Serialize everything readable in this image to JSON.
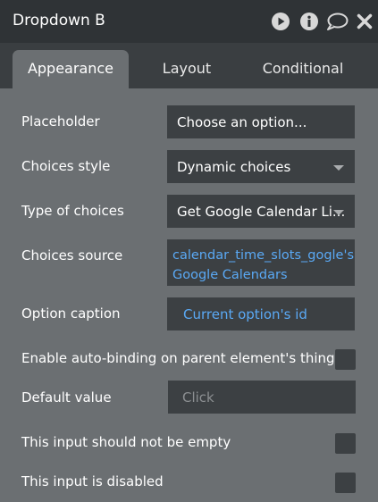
{
  "header": {
    "title": "Dropdown B",
    "icons": [
      "play-icon",
      "info-icon",
      "comment-icon",
      "close-icon"
    ]
  },
  "tabs": [
    {
      "label": "Appearance",
      "active": true
    },
    {
      "label": "Layout",
      "active": false
    },
    {
      "label": "Conditional",
      "active": false
    }
  ],
  "fields": {
    "placeholder": {
      "label": "Placeholder",
      "value": "Choose an option..."
    },
    "choices_style": {
      "label": "Choices style",
      "value": "Dynamic choices"
    },
    "type_of_choices": {
      "label": "Type of choices",
      "value": "Get Google Calendar Li..."
    },
    "choices_source": {
      "label": "Choices source",
      "line1": "calendar_time_slots_gogle's",
      "line2": "Google Calendars"
    },
    "option_caption": {
      "label": "Option caption",
      "value": "Current option's id"
    },
    "auto_binding": {
      "label": "Enable auto-binding on parent element's thing"
    },
    "default_value": {
      "label": "Default value",
      "placeholder": "Click"
    },
    "not_empty": {
      "label": "This input should not be empty"
    },
    "disabled": {
      "label": "This input is disabled"
    }
  },
  "colors": {
    "header_bg": "#2f3336",
    "panel_bg": "#6b6f72",
    "field_bg": "#3c4043",
    "dynamic_text": "#5aa9f5"
  }
}
